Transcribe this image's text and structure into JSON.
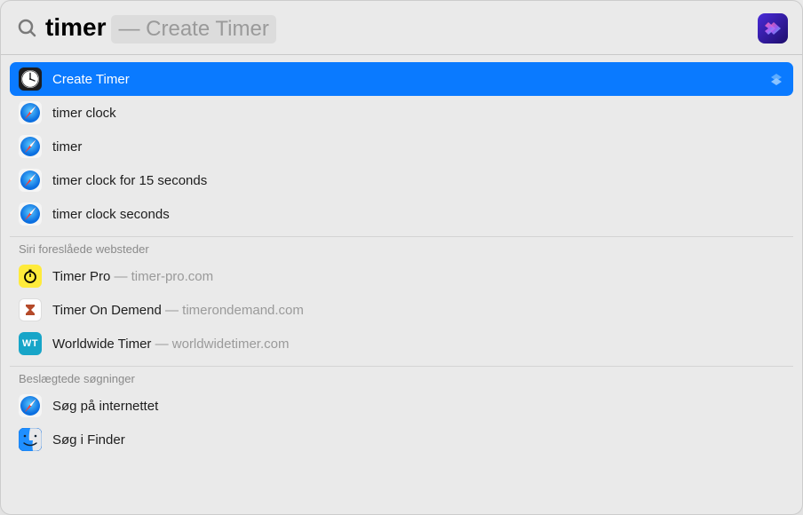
{
  "search": {
    "typed": "timer",
    "suggestion_separator": "—",
    "suggestion": "Create Timer"
  },
  "top_hit": {
    "label": "Create Timer",
    "icon": "clock-app-icon"
  },
  "suggestions": [
    {
      "label": "timer clock",
      "icon": "safari-icon"
    },
    {
      "label": "timer",
      "icon": "safari-icon"
    },
    {
      "label": "timer clock for 15 seconds",
      "icon": "safari-icon"
    },
    {
      "label": "timer clock seconds",
      "icon": "safari-icon"
    }
  ],
  "sections": {
    "siri_websites": {
      "title": "Siri foreslåede websteder",
      "items": [
        {
          "name": "Timer Pro",
          "domain": "timer-pro.com",
          "icon": "stopwatch-app-icon"
        },
        {
          "name": "Timer On Demend",
          "domain": "timerondemand.com",
          "icon": "hourglass-app-icon"
        },
        {
          "name": "Worldwide Timer",
          "domain": "worldwidetimer.com",
          "icon": "wt-app-icon"
        }
      ]
    },
    "related": {
      "title": "Beslægtede søgninger",
      "items": [
        {
          "label": "Søg på internettet",
          "icon": "safari-icon"
        },
        {
          "label": "Søg i Finder",
          "icon": "finder-icon"
        }
      ]
    }
  },
  "colors": {
    "selection": "#0a7aff",
    "safari_blue": "#1f8fff",
    "timerpro_bg": "#ffeb3b",
    "hourglass_bg": "#ffffff",
    "wt_teal": "#17a5c8"
  }
}
